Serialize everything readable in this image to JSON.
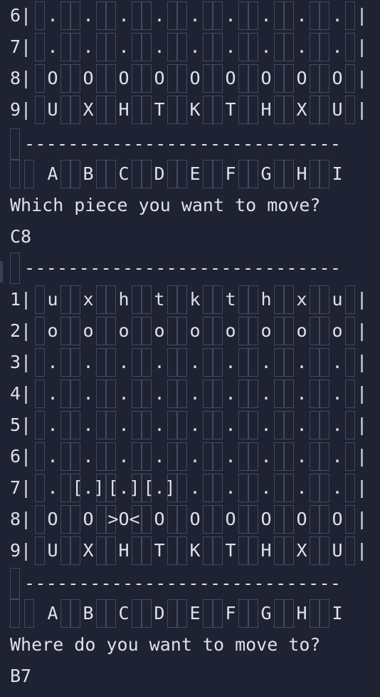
{
  "board1": {
    "rows": [
      {
        "label": "6|",
        "cells": [
          ".",
          ".",
          ".",
          ".",
          ".",
          ".",
          ".",
          ".",
          "."
        ]
      },
      {
        "label": "7|",
        "cells": [
          ".",
          ".",
          ".",
          ".",
          ".",
          ".",
          ".",
          ".",
          "."
        ]
      },
      {
        "label": "8|",
        "cells": [
          "O",
          "O",
          "O",
          "O",
          "O",
          "O",
          "O",
          "O",
          "O"
        ]
      },
      {
        "label": "9|",
        "cells": [
          "U",
          "X",
          "H",
          "T",
          "K",
          "T",
          "H",
          "X",
          "U"
        ]
      }
    ],
    "end_pipe": "|",
    "divider": "-----------------------------",
    "columns": [
      "A",
      "B",
      "C",
      "D",
      "E",
      "F",
      "G",
      "H",
      "I"
    ],
    "prompt": "Which piece you want to move?",
    "input": "C8"
  },
  "board2": {
    "divider": "-----------------------------",
    "rows": [
      {
        "label": "1|",
        "cells": [
          "u",
          "x",
          "h",
          "t",
          "k",
          "t",
          "h",
          "x",
          "u"
        ]
      },
      {
        "label": "2|",
        "cells": [
          "o",
          "o",
          "o",
          "o",
          "o",
          "o",
          "o",
          "o",
          "o"
        ]
      },
      {
        "label": "3|",
        "cells": [
          ".",
          ".",
          ".",
          ".",
          ".",
          ".",
          ".",
          ".",
          "."
        ]
      },
      {
        "label": "4|",
        "cells": [
          ".",
          ".",
          ".",
          ".",
          ".",
          ".",
          ".",
          ".",
          "."
        ]
      },
      {
        "label": "5|",
        "cells": [
          ".",
          ".",
          ".",
          ".",
          ".",
          ".",
          ".",
          ".",
          "."
        ]
      },
      {
        "label": "6|",
        "cells": [
          ".",
          ".",
          ".",
          ".",
          ".",
          ".",
          ".",
          ".",
          "."
        ]
      },
      {
        "label": "7|",
        "cells": [
          ".",
          "[.]",
          "[.]",
          "[.]",
          ".",
          ".",
          ".",
          ".",
          "."
        ]
      },
      {
        "label": "8|",
        "cells": [
          "O",
          "O",
          ">O<",
          "O",
          "O",
          "O",
          "O",
          "O",
          "O"
        ]
      },
      {
        "label": "9|",
        "cells": [
          "U",
          "X",
          "H",
          "T",
          "K",
          "T",
          "H",
          "X",
          "U"
        ]
      }
    ],
    "end_pipe": "|",
    "bottom_divider": "-----------------------------",
    "columns": [
      "A",
      "B",
      "C",
      "D",
      "E",
      "F",
      "G",
      "H",
      "I"
    ],
    "prompt": "Where do you want to move to?",
    "input": "B7"
  }
}
